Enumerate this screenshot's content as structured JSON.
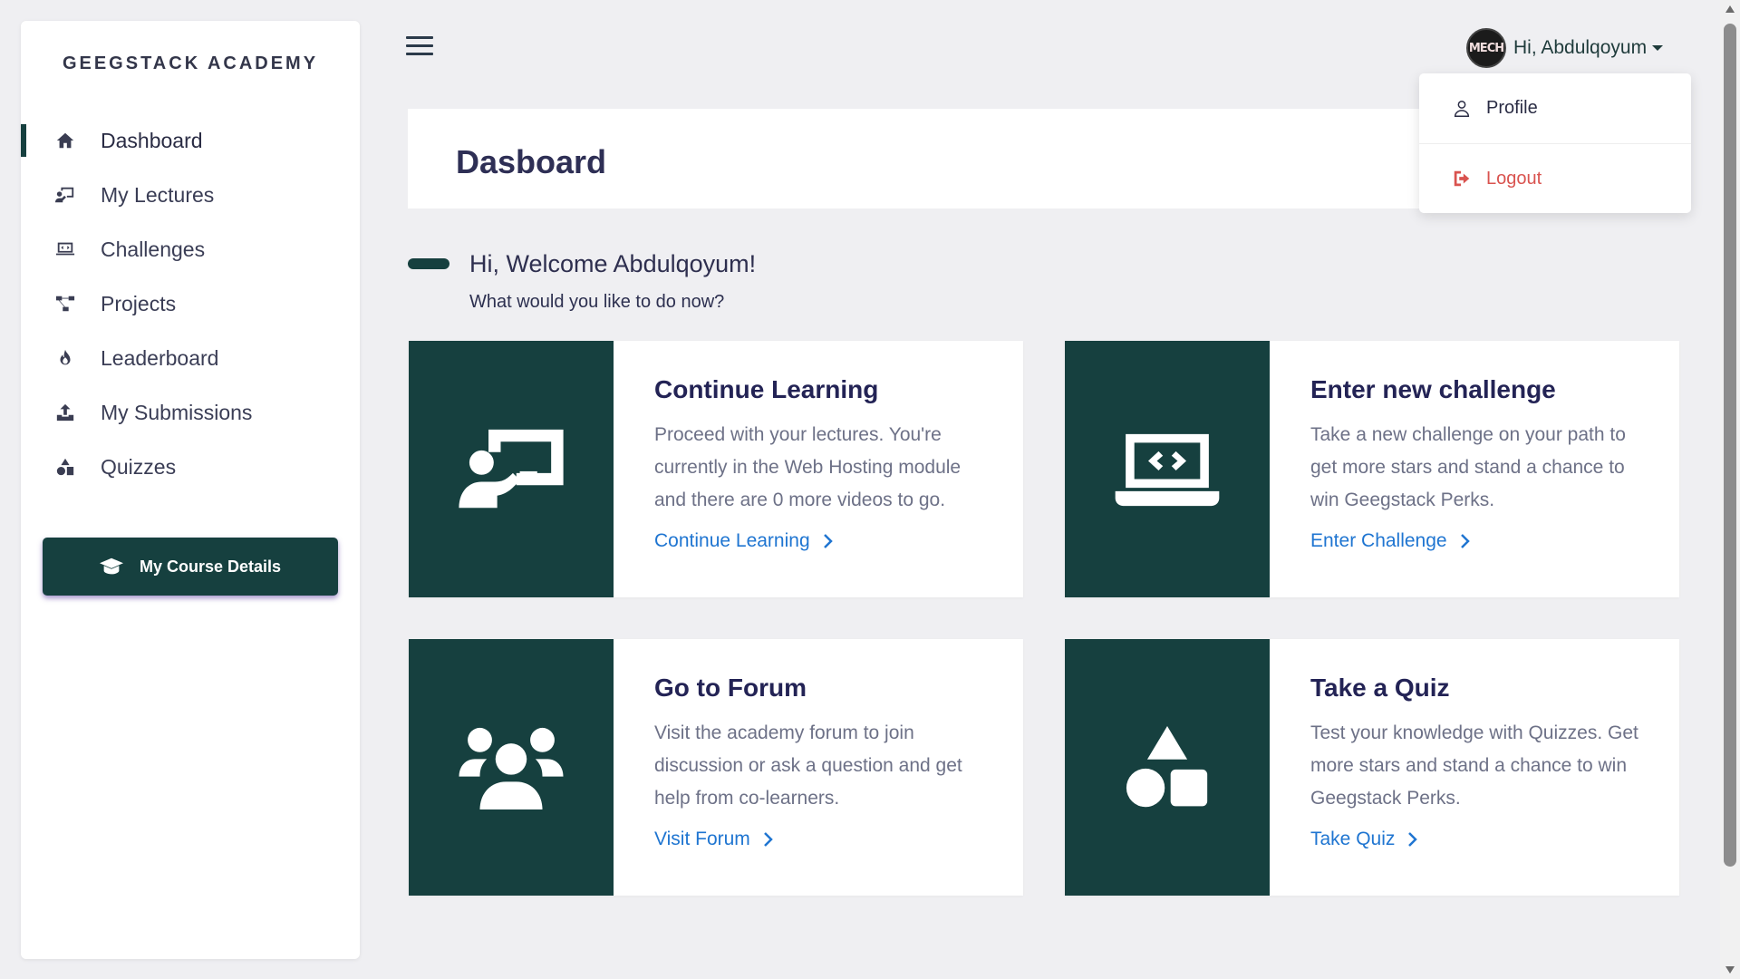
{
  "sidebar": {
    "brand": "GEEGSTACK ACADEMY",
    "items": [
      {
        "label": "Dashboard",
        "icon": "home-icon",
        "active": true
      },
      {
        "label": "My Lectures",
        "icon": "lecture-icon"
      },
      {
        "label": "Challenges",
        "icon": "code-laptop-icon"
      },
      {
        "label": "Projects",
        "icon": "project-diagram-icon"
      },
      {
        "label": "Leaderboard",
        "icon": "fire-icon"
      },
      {
        "label": "My Submissions",
        "icon": "upload-icon"
      },
      {
        "label": "Quizzes",
        "icon": "shapes-icon"
      }
    ],
    "course_button": "My Course Details"
  },
  "topbar": {
    "avatar_text": "MECH",
    "user_greeting": "Hi, Abdulqoyum"
  },
  "dropdown": {
    "profile": "Profile",
    "logout": "Logout"
  },
  "page": {
    "title": "Dasboard",
    "welcome_title": "Hi, Welcome Abdulqoyum!",
    "welcome_sub": "What would you like to do now?"
  },
  "cards": [
    {
      "title": "Continue Learning",
      "desc": "Proceed with your lectures. You're currently in the Web Hosting module and there are 0 more videos to go.",
      "link": "Continue Learning",
      "icon": "lecture-icon"
    },
    {
      "title": "Enter new challenge",
      "desc": "Take a new challenge on your path to get more stars and stand a chance to win Geegstack Perks.",
      "link": "Enter Challenge",
      "icon": "code-laptop-icon"
    },
    {
      "title": "Go to Forum",
      "desc": "Visit the academy forum to join discussion or ask a question and get help from co-learners.",
      "link": "Visit Forum",
      "icon": "users-icon"
    },
    {
      "title": "Take a Quiz",
      "desc": "Test your knowledge with Quizzes. Get more stars and stand a chance to win Geegstack Perks.",
      "link": "Take Quiz",
      "icon": "shapes-icon"
    }
  ],
  "colors": {
    "brand_dark": "#16403f",
    "link_blue": "#1f75d1",
    "logout_red": "#d9534f",
    "background": "#efeff2"
  }
}
